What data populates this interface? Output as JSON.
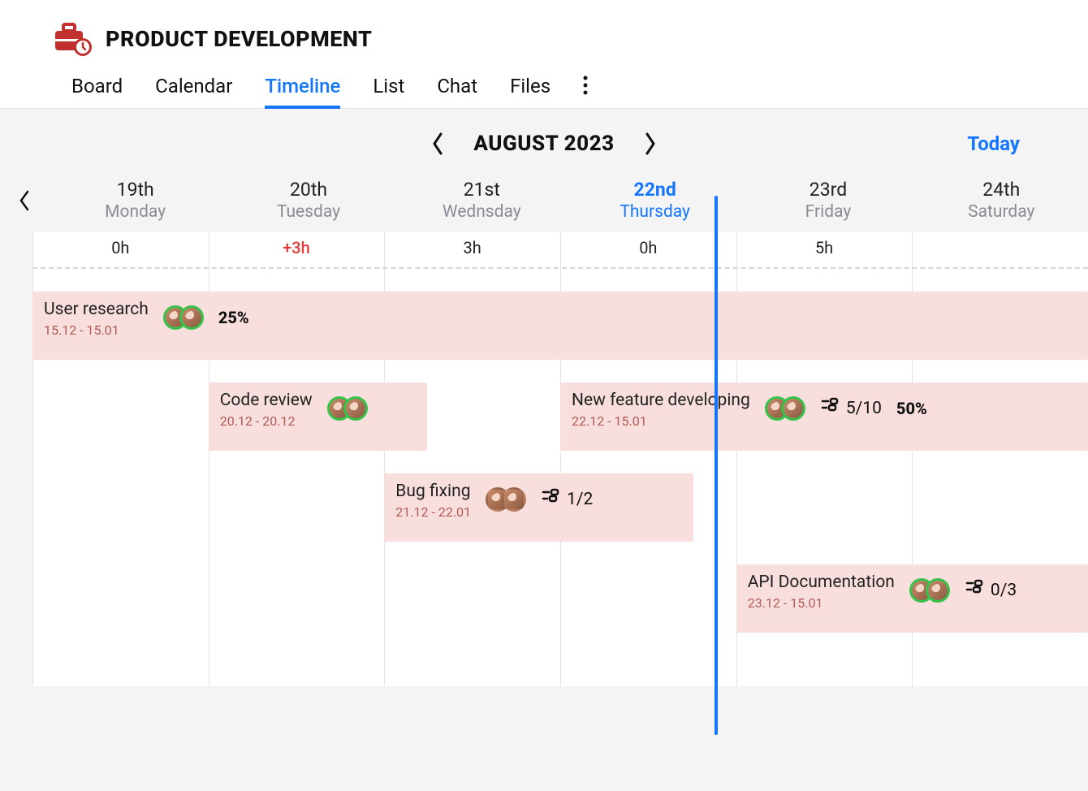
{
  "header": {
    "title": "PRODUCT DEVELOPMENT",
    "tabs": [
      "Board",
      "Calendar",
      "Timeline",
      "List",
      "Chat",
      "Files"
    ],
    "active_tab": "Timeline"
  },
  "month_nav": {
    "label": "AUGUST 2023",
    "today_label": "Today"
  },
  "days": [
    {
      "num": "19th",
      "name": "Monday",
      "today": false
    },
    {
      "num": "20th",
      "name": "Tuesday",
      "today": false
    },
    {
      "num": "21st",
      "name": "Wednsday",
      "today": false
    },
    {
      "num": "22nd",
      "name": "Thursday",
      "today": true
    },
    {
      "num": "23rd",
      "name": "Friday",
      "today": false
    },
    {
      "num": "24th",
      "name": "Saturday",
      "today": false
    }
  ],
  "hours": [
    {
      "text": "0h",
      "over": false
    },
    {
      "text": "+3h",
      "over": true
    },
    {
      "text": "3h",
      "over": false
    },
    {
      "text": "0h",
      "over": false
    },
    {
      "text": "5h",
      "over": false
    },
    {
      "text": "",
      "over": false
    }
  ],
  "today_line_pct": 64.6,
  "tasks": [
    {
      "row": 0,
      "left_pct": 0,
      "width_pct": 100,
      "title": "User research",
      "dates": "15.12 - 15.01",
      "avatars": 2,
      "avatar_ring": true,
      "percent": "25%",
      "subtasks": null
    },
    {
      "row": 1,
      "left_pct": 16.67,
      "width_pct": 20.7,
      "title": "Code review",
      "dates": "20.12 - 20.12",
      "avatars": 2,
      "avatar_ring": true,
      "percent": null,
      "subtasks": null
    },
    {
      "row": 1,
      "left_pct": 50,
      "width_pct": 50,
      "title": "New feature developing",
      "dates": "22.12 - 15.01",
      "avatars": 2,
      "avatar_ring": true,
      "percent": "50%",
      "subtasks": "5/10"
    },
    {
      "row": 2,
      "left_pct": 33.33,
      "width_pct": 29.3,
      "title": "Bug fixing",
      "dates": "21.12 - 22.01",
      "avatars": 2,
      "avatar_ring": false,
      "percent": null,
      "subtasks": "1/2"
    },
    {
      "row": 3,
      "left_pct": 66.67,
      "width_pct": 33.33,
      "title": "API Documentation",
      "dates": "23.12 - 15.01",
      "avatars": 2,
      "avatar_ring": true,
      "percent": null,
      "subtasks": "0/3"
    }
  ]
}
